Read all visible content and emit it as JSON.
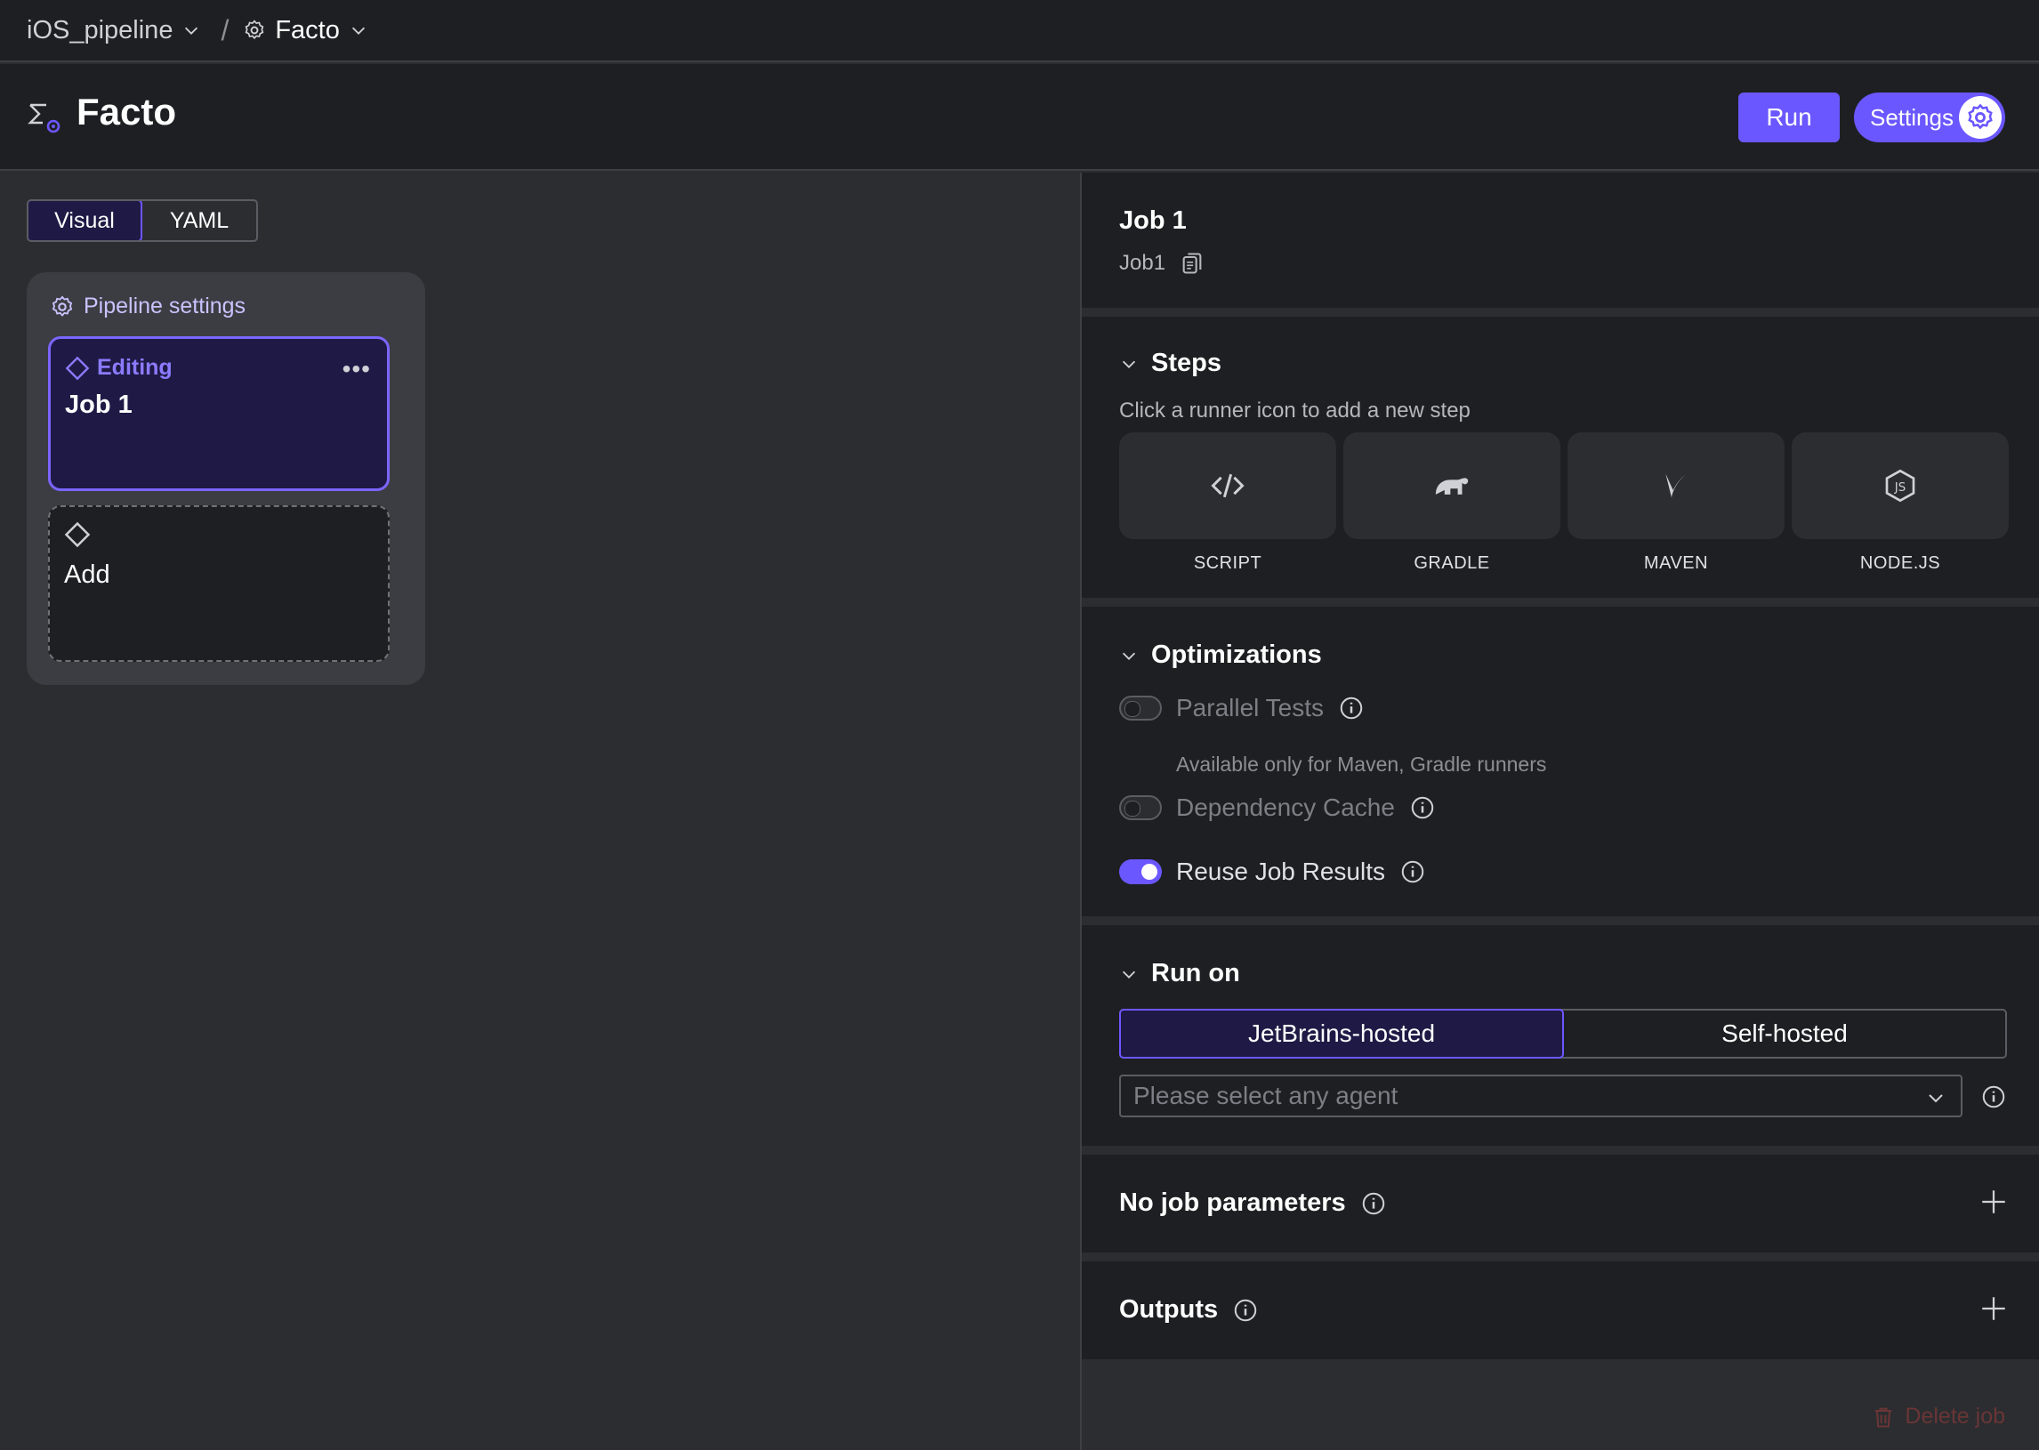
{
  "breadcrumb": {
    "project": "iOS_pipeline",
    "separator": "/",
    "pipeline": "Facto"
  },
  "header": {
    "title": "Facto",
    "run_label": "Run",
    "settings_label": "Settings"
  },
  "editor": {
    "tabs": [
      {
        "label": "Visual",
        "active": true
      },
      {
        "label": "YAML",
        "active": false
      }
    ],
    "pipeline_settings_label": "Pipeline settings",
    "job_card": {
      "status": "Editing",
      "name": "Job 1"
    },
    "add_card_label": "Add"
  },
  "job": {
    "title": "Job 1",
    "id": "Job1"
  },
  "steps": {
    "title": "Steps",
    "hint": "Click a runner icon to add a new step",
    "runners": [
      {
        "label": "SCRIPT",
        "icon": "code-icon"
      },
      {
        "label": "GRADLE",
        "icon": "gradle-elephant-icon"
      },
      {
        "label": "MAVEN",
        "icon": "maven-feather-icon"
      },
      {
        "label": "NODE.JS",
        "icon": "nodejs-hexagon-icon"
      }
    ]
  },
  "optimizations": {
    "title": "Optimizations",
    "parallel_tests": {
      "label": "Parallel Tests",
      "enabled": false,
      "note": "Available only for Maven, Gradle runners"
    },
    "dependency_cache": {
      "label": "Dependency Cache",
      "enabled": false
    },
    "reuse_job_results": {
      "label": "Reuse Job Results",
      "enabled": true
    }
  },
  "run_on": {
    "title": "Run on",
    "options": [
      {
        "label": "JetBrains-hosted",
        "active": true
      },
      {
        "label": "Self-hosted",
        "active": false
      }
    ],
    "agent_placeholder": "Please select any agent"
  },
  "parameters": {
    "title": "No job parameters"
  },
  "outputs": {
    "title": "Outputs"
  },
  "delete_label": "Delete job",
  "colors": {
    "accent": "#6b57ff",
    "panel": "#1e1f22",
    "background": "#2b2d30",
    "danger": "#6a3536"
  }
}
